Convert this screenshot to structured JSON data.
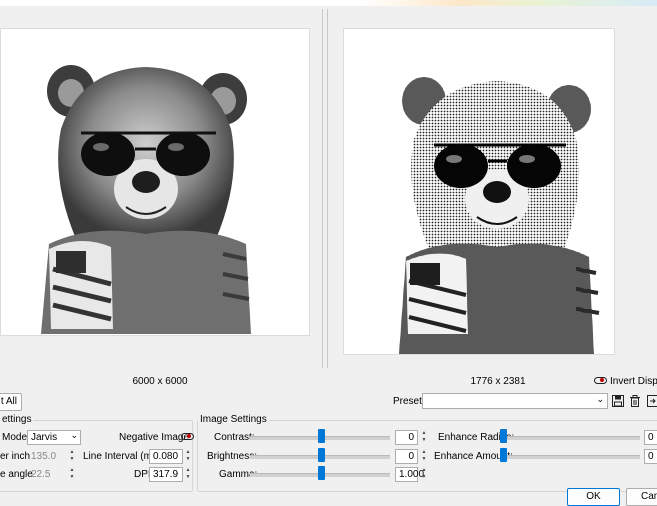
{
  "images": {
    "original": {
      "caption": "6000 x 6000",
      "subject": "bear wearing sunglasses and flag jacket"
    },
    "processed": {
      "caption": "1776 x 2381",
      "subject": "dithered bear wearing sunglasses and flag jacket"
    }
  },
  "toolbar": {
    "all_button": "t All",
    "invert_display_label": "Invert Display",
    "presets_label": "Presets",
    "presets_value": ""
  },
  "settings_group": {
    "title": "ettings",
    "mode_label": "Mode:",
    "mode_value": "Jarvis",
    "negative_image_label": "Negative Image",
    "per_inch_label": "er inch",
    "per_inch_value": "135.0",
    "line_interval_label": "Line Interval (mm)",
    "line_interval_value": "0.080",
    "angle_label": "e angle",
    "angle_value": "22.5",
    "dpi_label": "DPI",
    "dpi_value": "317.9"
  },
  "image_settings": {
    "title": "Image Settings",
    "contrast_label": "Contrast:",
    "contrast_value": "0",
    "contrast_level": 0.5,
    "brightness_label": "Brightness:",
    "brightness_value": "0",
    "brightness_level": 0.5,
    "gamma_label": "Gamma:",
    "gamma_value": "1.000",
    "gamma_level": 0.5,
    "enhance_radius_label": "Enhance Radius:",
    "enhance_radius_value": "0",
    "enhance_amount_label": "Enhance Amount:",
    "enhance_amount_value": "0"
  },
  "dialog_buttons": {
    "ok": "OK",
    "cancel": "Canc"
  },
  "icons": {
    "save": "save-icon",
    "delete": "trash-icon",
    "export": "export-icon"
  },
  "colors": {
    "slider_accent": "#0078d7",
    "toggle_off": "#c00000"
  }
}
